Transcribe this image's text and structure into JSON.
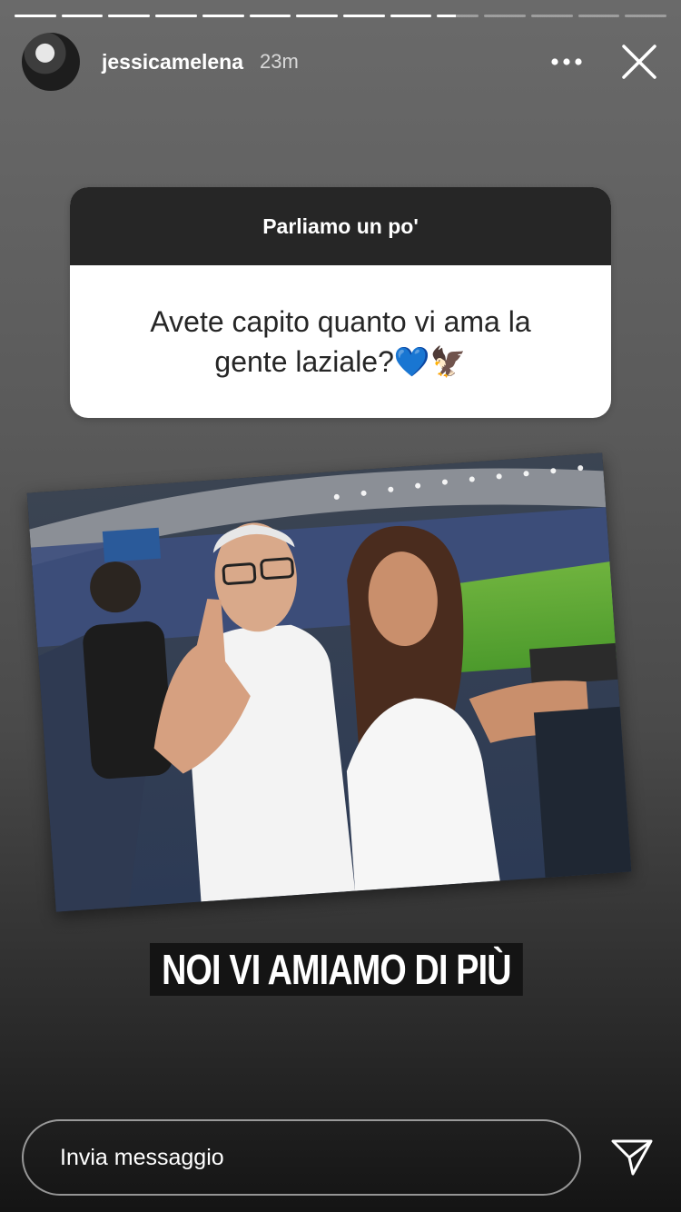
{
  "story": {
    "progress_total": 14,
    "progress_done": 9,
    "progress_current_fraction": 0.45
  },
  "header": {
    "username": "jessicamelena",
    "time": "23m",
    "more_icon": "more-horizontal-icon",
    "close_icon": "close-icon"
  },
  "question": {
    "title": "Parliamo un po'",
    "text": "Avete capito quanto vi ama la gente laziale?💙🦅"
  },
  "photo": {
    "description_icon": "photo"
  },
  "caption": {
    "text": "NOI VI AMIAMO DI PIÙ"
  },
  "footer": {
    "placeholder": "Invia messaggio",
    "send_icon": "send-icon"
  },
  "colors": {
    "card_header": "#262626",
    "card_body": "#ffffff",
    "sticker_bg": "#141414"
  }
}
